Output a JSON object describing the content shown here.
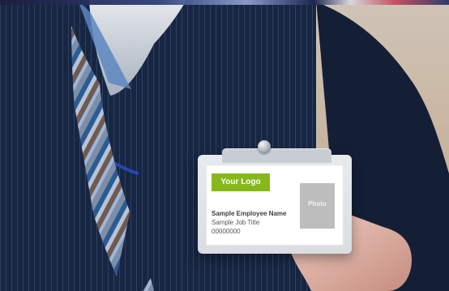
{
  "badge": {
    "logo": "Your Logo",
    "employee_name": "Sample Employee Name",
    "job_title": "Sample Job Title",
    "employee_number": "00000000",
    "photo_label": "Photo"
  },
  "colors": {
    "logo_green": "#86b81d",
    "photo_gray": "#bdbdbd",
    "lanyard_blue": "#2747b4",
    "suit_navy": "#1c2b45"
  }
}
